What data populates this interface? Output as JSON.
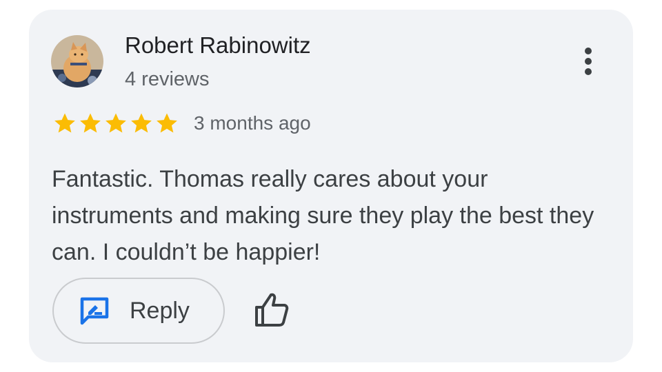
{
  "review": {
    "author_name": "Robert Rabinowitz",
    "author_reviews": "4 reviews",
    "rating": 5,
    "rating_max": 5,
    "time_ago": "3 months ago",
    "text": "Fantastic. Thomas really cares about your instruments and making sure they play the best they can. I couldn’t be happier!"
  },
  "actions": {
    "reply_label": "Reply",
    "reply_icon": "reply-comment-icon",
    "like_icon": "thumb-up-icon",
    "more_icon": "more-vert-icon"
  },
  "colors": {
    "card_background": "#f1f3f6",
    "star": "#fbbc04",
    "reply_icon": "#1a73e8",
    "text_primary": "#202124",
    "text_secondary": "#5f6368"
  }
}
